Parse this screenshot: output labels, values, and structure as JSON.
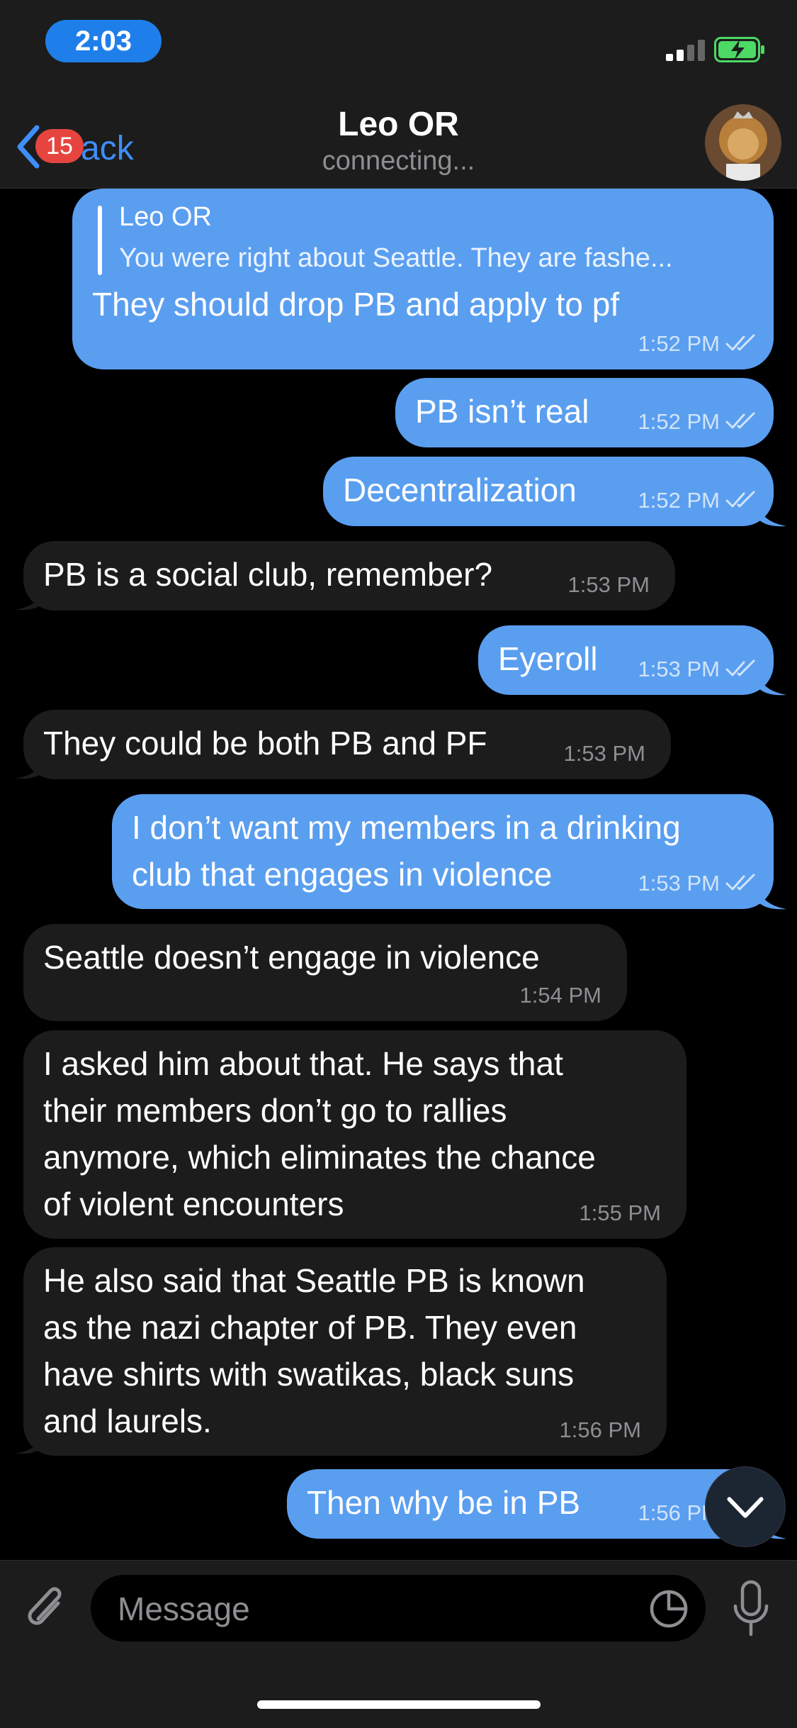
{
  "status_bar": {
    "time": "2:03"
  },
  "header": {
    "back_label": "Back",
    "unread_count": "15",
    "title": "Leo OR",
    "subtitle": "connecting..."
  },
  "messages": [
    {
      "direction": "out",
      "reply_to": {
        "name": "Leo OR",
        "text": "You were right about Seattle. They are fashe..."
      },
      "text": "They should drop PB and apply to pf",
      "time": "1:52 PM",
      "read": true
    },
    {
      "direction": "out",
      "text": "PB isn’t real",
      "time": "1:52 PM",
      "read": true
    },
    {
      "direction": "out",
      "text": "Decentralization",
      "time": "1:52 PM",
      "read": true
    },
    {
      "direction": "in",
      "text": "PB is a social club, remember?",
      "time": "1:53 PM"
    },
    {
      "direction": "out",
      "text": "Eyeroll",
      "time": "1:53 PM",
      "read": true
    },
    {
      "direction": "in",
      "text": "They could be both PB and PF",
      "time": "1:53 PM"
    },
    {
      "direction": "out",
      "text": "I don’t want my members in a drinking\nclub that engages in violence",
      "time": "1:53 PM",
      "read": true
    },
    {
      "direction": "in",
      "text": "Seattle doesn’t engage in violence",
      "time": "1:54 PM"
    },
    {
      "direction": "in",
      "text": "I asked him about that. He says that\ntheir members don’t go to rallies\nanymore, which eliminates the chance\nof violent encounters",
      "time": "1:55 PM"
    },
    {
      "direction": "in",
      "text": "He also said that Seattle PB is known\nas the nazi chapter of PB. They even\nhave shirts with swatikas, black suns\nand laurels.",
      "time": "1:56 PM"
    },
    {
      "direction": "out",
      "text": "Then why be in PB",
      "time": "1:56 PM",
      "read": true
    }
  ],
  "input": {
    "placeholder": "Message"
  },
  "icons": {
    "back": "chevron-left-icon",
    "attach": "paperclip-icon",
    "sticker": "sticker-icon",
    "mic": "microphone-icon",
    "scroll_down": "chevron-down-icon",
    "read_receipt": "double-check-icon"
  },
  "colors": {
    "outgoing_bubble": "#5a9ef0",
    "incoming_bubble": "#1c1c1d",
    "accent": "#3e8ef7",
    "badge": "#e5453e",
    "background": "#000000"
  }
}
